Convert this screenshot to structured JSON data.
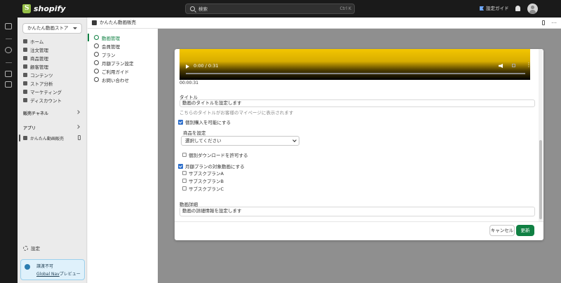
{
  "topbar": {
    "brand": "shopify",
    "search_placeholder": "検索",
    "search_shortcut": "Ctrl K",
    "setup_guide": "設定ガイド"
  },
  "nav": {
    "store": "かんたん動画ストア",
    "items": [
      {
        "label": "ホーム",
        "icon": "home-icon"
      },
      {
        "label": "注文管理",
        "icon": "orders-icon"
      },
      {
        "label": "商品管理",
        "icon": "tag-icon"
      },
      {
        "label": "顧客管理",
        "icon": "person-icon"
      },
      {
        "label": "コンテンツ",
        "icon": "content-icon"
      },
      {
        "label": "ストア分析",
        "icon": "chart-icon"
      },
      {
        "label": "マーケティング",
        "icon": "target-icon"
      },
      {
        "label": "ディスカウント",
        "icon": "discount-icon"
      }
    ],
    "sales_channels": "販売チャネル",
    "apps": "アプリ",
    "app_item": "かんたん動画販売",
    "settings": "設定",
    "banner_line1": "譲渡不可",
    "banner_link": "Global Nav",
    "banner_suffix": "プレビュー"
  },
  "app": {
    "title": "かんたん動画販売",
    "subnav": [
      {
        "label": "動画管理",
        "active": true
      },
      {
        "label": "会員管理",
        "active": false
      },
      {
        "label": "プラン",
        "active": false
      },
      {
        "label": "月額プラン設定",
        "active": false
      },
      {
        "label": "ご利用ガイド",
        "active": false
      },
      {
        "label": "お問い合わせ",
        "active": false
      }
    ]
  },
  "modal": {
    "video_time": "0:00 / 0:31",
    "video_progress": 0,
    "duration": "00:00:31",
    "title_label": "タイトル",
    "title_value": "動画のタイトルを設定します",
    "title_help": "こちらのタイトルがお客様のマイページに表示されます",
    "individual_purchase": "個別購入を可能にする",
    "individual_purchase_checked": true,
    "product_label": "商品を設定",
    "product_select": "選択してください",
    "allow_download": "個別ダウンロードを許可する",
    "allow_download_checked": false,
    "monthly_plan": "月額プランの対象動画にする",
    "monthly_plan_checked": true,
    "plans": [
      {
        "label": "サブスクプランA",
        "checked": false
      },
      {
        "label": "サブスクプランB",
        "checked": false
      },
      {
        "label": "サブスクプランC",
        "checked": false
      }
    ],
    "detail_label": "動画詳細",
    "detail_value": "動画の詳細情報を設定します",
    "cancel": "キャンセル",
    "update": "更新"
  },
  "colors": {
    "accent": "#108043",
    "checkbox": "#2c6ecb",
    "overlay": "#8f8f8f"
  }
}
